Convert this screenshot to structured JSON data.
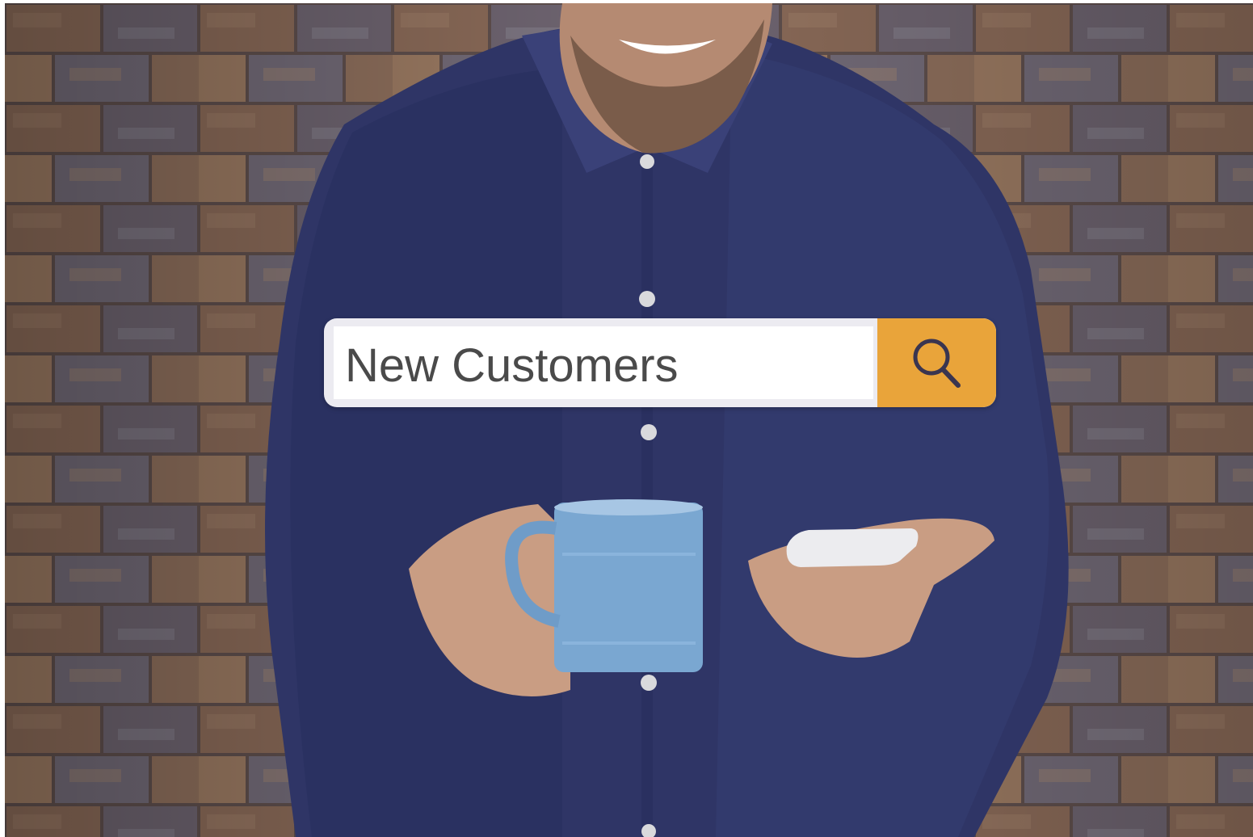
{
  "search": {
    "query": "New Customers",
    "button_icon": "search-icon"
  },
  "colors": {
    "search_button": "#e9a43a",
    "bar_background": "#ecebf1",
    "text": "#4a4a4a",
    "icon": "#3a3550"
  }
}
